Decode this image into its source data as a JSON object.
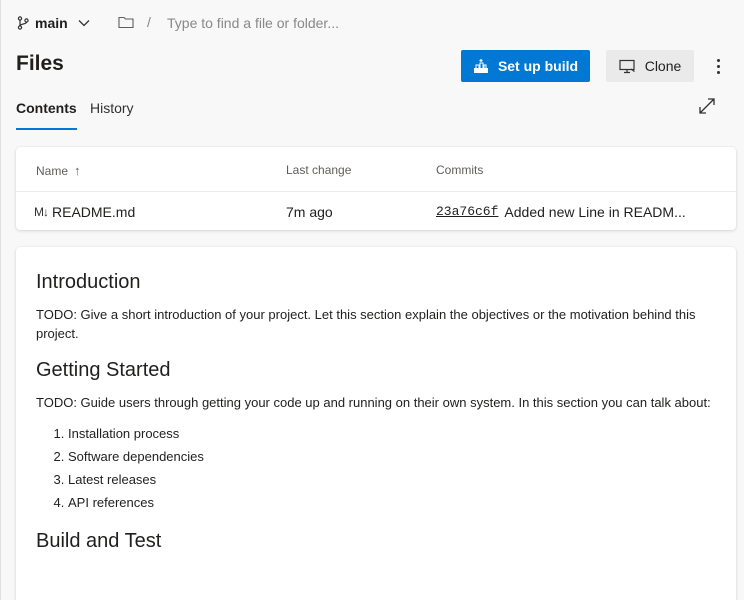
{
  "topbar": {
    "branch": "main",
    "path_separator": "/",
    "path_placeholder": "Type to find a file or folder..."
  },
  "page": {
    "title": "Files",
    "setup_build_label": "Set up build",
    "clone_label": "Clone"
  },
  "tabs": [
    {
      "label": "Contents",
      "active": true
    },
    {
      "label": "History",
      "active": false
    }
  ],
  "files_table": {
    "columns": [
      "Name",
      "Last change",
      "Commits"
    ],
    "sort_indicator": "↑",
    "rows": [
      {
        "icon": "M↓",
        "name": "README.md",
        "last_change": "7m ago",
        "commit_hash": "23a76c6f",
        "commit_message": "Added new Line in READM..."
      }
    ]
  },
  "readme": {
    "sections": [
      {
        "heading": "Introduction",
        "body": "TODO: Give a short introduction of your project. Let this section explain the objectives or the motivation behind this project."
      },
      {
        "heading": "Getting Started",
        "body": "TODO: Guide users through getting your code up and running on their own system. In this section you can talk about:",
        "list": [
          "Installation process",
          "Software dependencies",
          "Latest releases",
          "API references"
        ]
      },
      {
        "heading": "Build and Test"
      }
    ]
  },
  "colors": {
    "accent": "#0078d4",
    "background": "#f8f8f8",
    "card": "#ffffff"
  }
}
